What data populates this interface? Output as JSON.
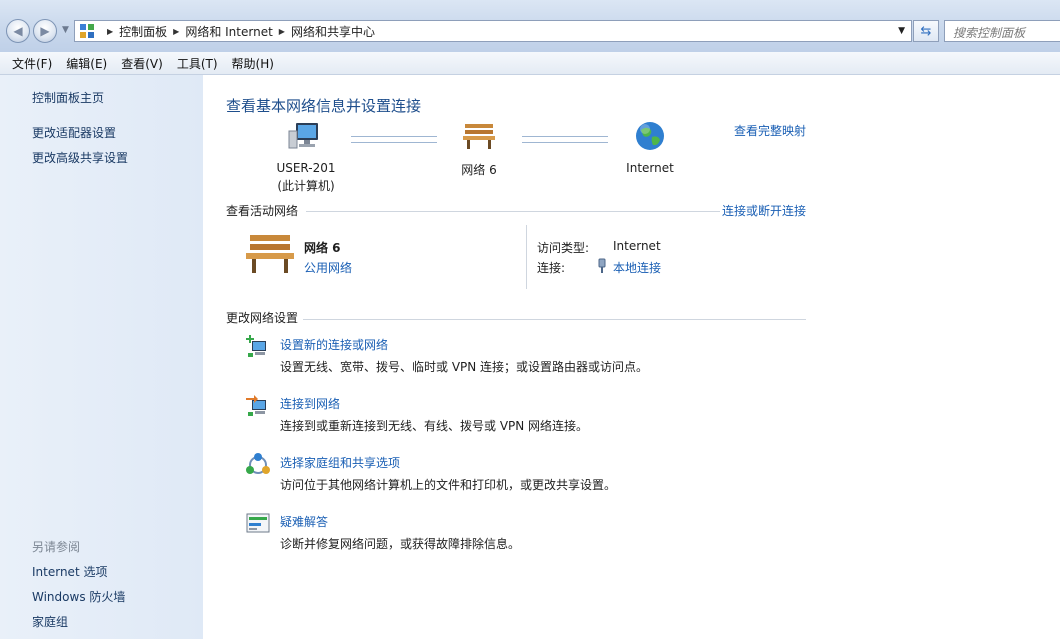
{
  "address": {
    "breadcrumbs": [
      "控制面板",
      "网络和 Internet",
      "网络和共享中心"
    ],
    "search_placeholder": "搜索控制面板"
  },
  "menu": [
    "文件(F)",
    "编辑(E)",
    "查看(V)",
    "工具(T)",
    "帮助(H)"
  ],
  "left_pane": {
    "links": [
      "控制面板主页",
      "更改适配器设置",
      "更改高级共享设置"
    ],
    "see_also_title": "另请参阅",
    "see_also": [
      "Internet 选项",
      "Windows 防火墙",
      "家庭组"
    ]
  },
  "main": {
    "title": "查看基本网络信息并设置连接",
    "map": {
      "computer_name": "USER-201",
      "computer_sub": "(此计算机)",
      "network": "网络  6",
      "internet": "Internet",
      "full_map_link": "查看完整映射"
    },
    "active": {
      "section_title": "查看活动网络",
      "connect_link": "连接或断开连接",
      "network_name": "网络  6",
      "network_type": "公用网络",
      "access_label": "访问类型:",
      "access_value": "Internet",
      "connection_label": "连接:",
      "connection_value": "本地连接"
    },
    "change": {
      "section_title": "更改网络设置",
      "tasks": [
        {
          "title": "设置新的连接或网络",
          "desc": "设置无线、宽带、拨号、临时或 VPN 连接；或设置路由器或访问点。",
          "icon": "new-connection-icon"
        },
        {
          "title": "连接到网络",
          "desc": "连接到或重新连接到无线、有线、拨号或 VPN 网络连接。",
          "icon": "connect-network-icon"
        },
        {
          "title": "选择家庭组和共享选项",
          "desc": "访问位于其他网络计算机上的文件和打印机，或更改共享设置。",
          "icon": "homegroup-icon"
        },
        {
          "title": "疑难解答",
          "desc": "诊断并修复网络问题，或获得故障排除信息。",
          "icon": "troubleshoot-icon"
        }
      ]
    }
  }
}
